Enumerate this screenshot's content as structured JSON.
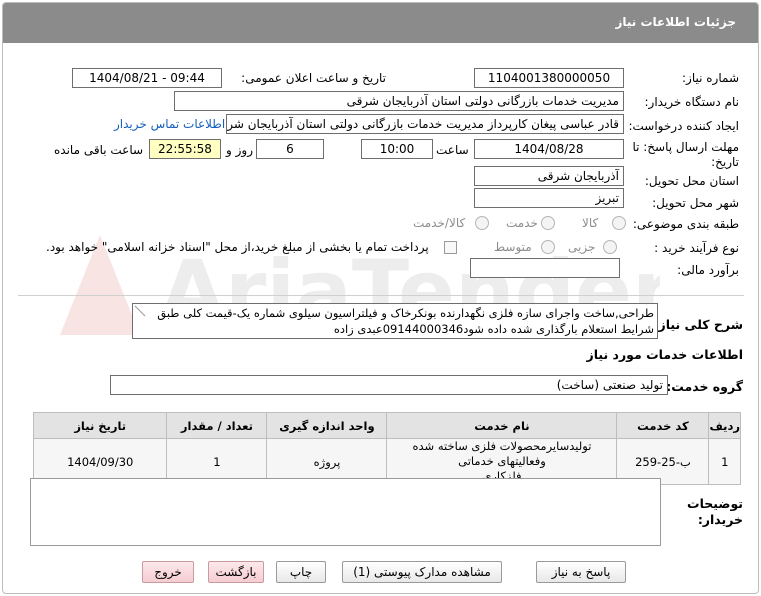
{
  "page_title": "جزئیات اطلاعات نیاز",
  "fields": {
    "need_number_label": "شماره نیاز:",
    "need_number": "1104001380000050",
    "announce_label": "تاریخ و ساعت اعلان عمومی:",
    "announce_value": "1404/08/21 - 09:44",
    "buyer_org_label": "نام دستگاه خریدار:",
    "buyer_org": "مدیریت خدمات بازرگانی دولتی استان آذربایجان شرقی",
    "creator_label": "ایجاد کننده درخواست:",
    "creator": "قادر عباسی پیغان کارپرداز مدیریت خدمات بازرگانی دولتی استان آذربایجان شرقی",
    "contact_link": "اطلاعات تماس خریدار",
    "deadline_label": "مهلت ارسال پاسخ: تا تاریخ:",
    "deadline_date": "1404/08/28",
    "time_label": "ساعت",
    "deadline_time": "10:00",
    "days_value": "6",
    "days_label": "روز و",
    "remaining_time": "22:55:58",
    "remaining_label": "ساعت باقی مانده",
    "province_label": "استان محل تحویل:",
    "province": "آذربایجان شرقی",
    "city_label": "شهر محل تحویل:",
    "city": "تبریز",
    "category_label": "طبقه بندی موضوعی:",
    "category_options": [
      "کالا",
      "خدمت",
      "کالا/خدمت"
    ],
    "process_label": "نوع فرآیند خرید :",
    "process_options": [
      "جزیی",
      "متوسط"
    ],
    "payment_note": "پرداخت تمام یا بخشی از مبلغ خرید،از محل \"اسناد خزانه اسلامی\" خواهد بود.",
    "estimate_label": "برآورد مالی:",
    "estimate_value": ""
  },
  "summary": {
    "label": "شرح کلی نیاز:",
    "line1": "طراحی,ساخت واجرای سازه فلزی نگهدارنده بونکرخاک و فیلتراسیون سیلوی شماره یک-قیمت کلی طبق",
    "line2": "شرایط استعلام بارگذاری شده داده شود09144000346عبدی زاده"
  },
  "services": {
    "section_title": "اطلاعات خدمات مورد نیاز",
    "group_label": "گروه خدمت:",
    "group_value": "تولید صنعتی (ساخت)"
  },
  "table": {
    "headers": [
      "ردیف",
      "کد خدمت",
      "نام خدمت",
      "واحد اندازه گیری",
      "تعداد / مقدار",
      "تاریخ نیاز"
    ],
    "rows": [
      {
        "row": "1",
        "code": "ب-25-259",
        "name_line1": "تولیدسایرمحصولات فلزی ساخته شده وفعالیتهای خدماتی",
        "name_line2": "فلزکاری",
        "unit": "پروژه",
        "qty": "1",
        "date": "1404/09/30"
      }
    ]
  },
  "buyer_notes": {
    "label_line1": "توضیحات",
    "label_line2": "خریدار:",
    "value": ""
  },
  "buttons": {
    "reply": "پاسخ به نیاز",
    "attachments": "مشاهده مدارک پیوستی (1)",
    "print": "چاپ",
    "back": "بازگشت",
    "exit": "خروج"
  },
  "watermark_text": "AriaTender.net",
  "colors": {
    "header_bg": "#8b8b8b",
    "link": "#1560bd",
    "remaining_bg": "#ffffc2",
    "pink_button": "#f5cdd2"
  }
}
